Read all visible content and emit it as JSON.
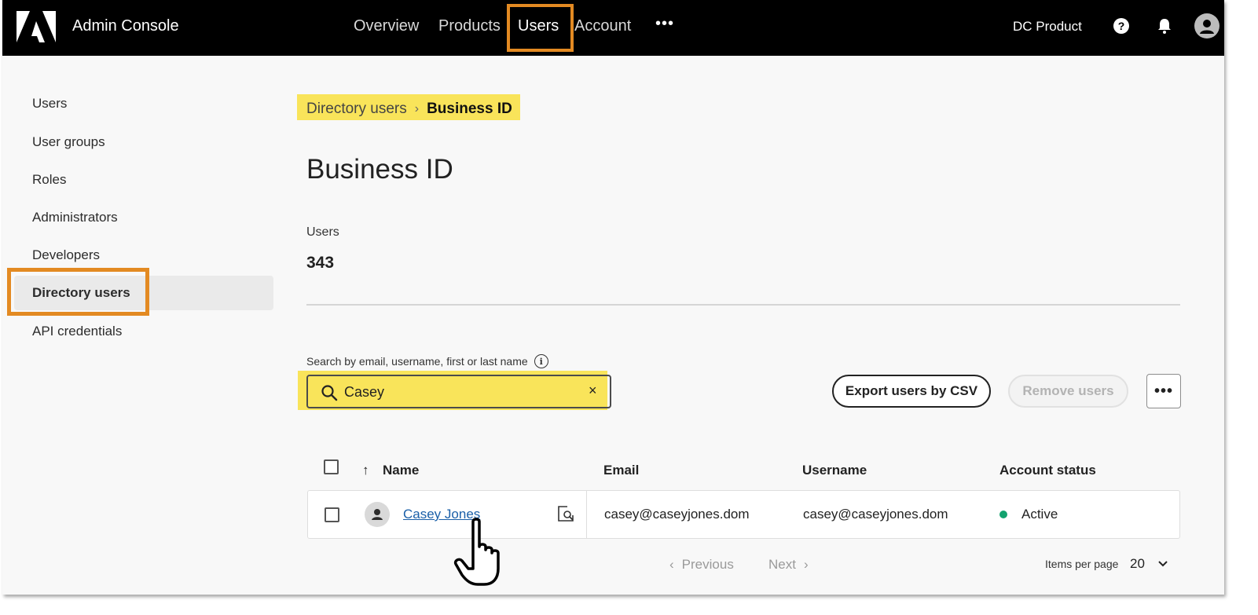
{
  "header": {
    "app_title": "Admin Console",
    "nav": [
      {
        "label": "Overview",
        "active": false
      },
      {
        "label": "Products",
        "active": false
      },
      {
        "label": "Users",
        "active": true
      },
      {
        "label": "Account",
        "active": false
      }
    ],
    "more_label": "•••",
    "org_name": "DC Product",
    "icons": [
      "help-icon",
      "notification-bell-icon",
      "user-avatar-icon"
    ]
  },
  "sidebar": {
    "items": [
      {
        "label": "Users"
      },
      {
        "label": "User groups"
      },
      {
        "label": "Roles"
      },
      {
        "label": "Administrators"
      },
      {
        "label": "Developers"
      },
      {
        "label": "Directory users",
        "selected": true
      },
      {
        "label": "API credentials"
      }
    ]
  },
  "breadcrumb": {
    "parent": "Directory users",
    "separator": "›",
    "current": "Business ID"
  },
  "main": {
    "title": "Business ID",
    "count_label": "Users",
    "count_value": "343",
    "search": {
      "label": "Search by email, username, first or last name",
      "value": "Casey",
      "clear": "×"
    },
    "buttons": {
      "export": "Export users by CSV",
      "remove": "Remove users",
      "more": "•••"
    },
    "table": {
      "columns": [
        "Name",
        "Email",
        "Username",
        "Account status"
      ],
      "rows": [
        {
          "name": "Casey Jones",
          "email": "casey@caseyjones.dom",
          "username": "casey@caseyjones.dom",
          "status": "Active"
        }
      ]
    },
    "pagination": {
      "previous": "Previous",
      "next": "Next",
      "items_per_page_label": "Items per page",
      "items_per_page_value": "20"
    }
  },
  "colors": {
    "highlight_orange": "#e38a22",
    "highlight_yellow": "#f9e45a",
    "status_active": "#12a26e",
    "link": "#1a5fa8"
  }
}
